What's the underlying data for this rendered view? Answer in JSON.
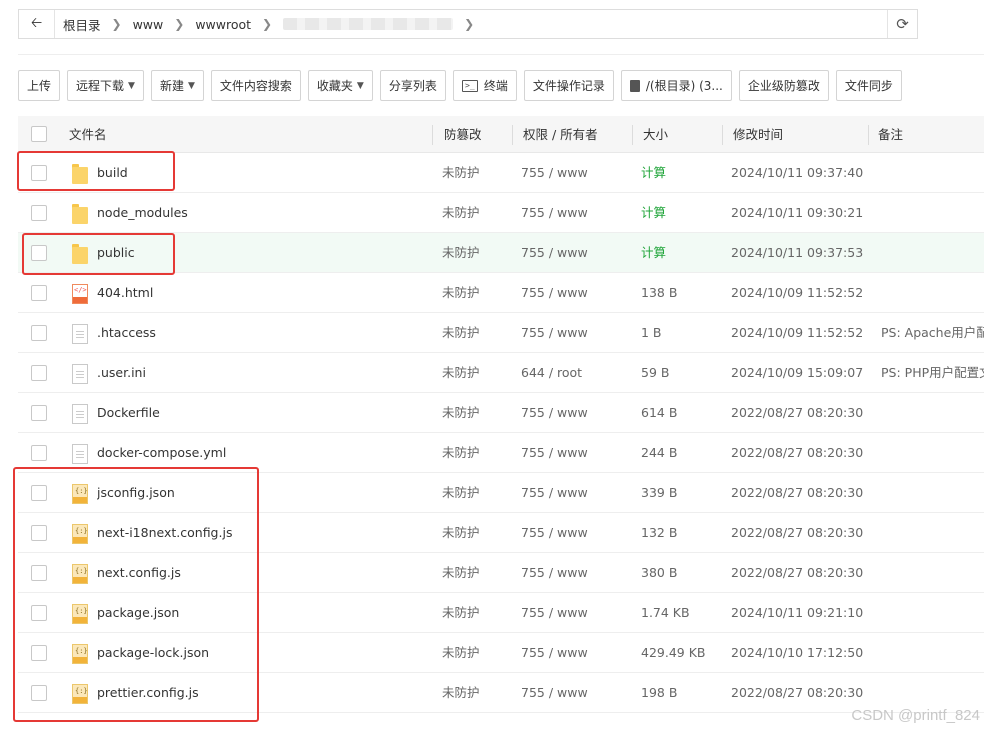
{
  "addressbar": {
    "crumbs": [
      "根目录",
      "www",
      "wwwroot"
    ]
  },
  "toolbar": {
    "upload": "上传",
    "remote_download": "远程下载",
    "new": "新建",
    "content_search": "文件内容搜索",
    "favorites": "收藏夹",
    "share_list": "分享列表",
    "terminal": "终端",
    "operation_log": "文件操作记录",
    "disk": "/(根目录) (3...",
    "tamper_protect": "企业级防篡改",
    "file_sync": "文件同步"
  },
  "table": {
    "headers": {
      "name": "文件名",
      "protect": "防篡改",
      "perm": "权限 / 所有者",
      "size": "大小",
      "mtime": "修改时间",
      "note": "备注"
    },
    "rows": [
      {
        "name": "build",
        "icon": "folder",
        "protect": "未防护",
        "perm": "755 / www",
        "size": "计算",
        "mtime": "2024/10/11 09:37:40",
        "note": ""
      },
      {
        "name": "node_modules",
        "icon": "folder",
        "protect": "未防护",
        "perm": "755 / www",
        "size": "计算",
        "mtime": "2024/10/11 09:30:21",
        "note": ""
      },
      {
        "name": "public",
        "icon": "folder",
        "protect": "未防护",
        "perm": "755 / www",
        "size": "计算",
        "mtime": "2024/10/11 09:37:53",
        "note": ""
      },
      {
        "name": "404.html",
        "icon": "html",
        "protect": "未防护",
        "perm": "755 / www",
        "size": "138 B",
        "mtime": "2024/10/09 11:52:52",
        "note": ""
      },
      {
        "name": ".htaccess",
        "icon": "doc",
        "protect": "未防护",
        "perm": "755 / www",
        "size": "1 B",
        "mtime": "2024/10/09 11:52:52",
        "note": "PS: Apache用户配置"
      },
      {
        "name": ".user.ini",
        "icon": "doc",
        "protect": "未防护",
        "perm": "644 / root",
        "size": "59 B",
        "mtime": "2024/10/09 15:09:07",
        "note": "PS: PHP用户配置文"
      },
      {
        "name": "Dockerfile",
        "icon": "doc",
        "protect": "未防护",
        "perm": "755 / www",
        "size": "614 B",
        "mtime": "2022/08/27 08:20:30",
        "note": ""
      },
      {
        "name": "docker-compose.yml",
        "icon": "doc",
        "protect": "未防护",
        "perm": "755 / www",
        "size": "244 B",
        "mtime": "2022/08/27 08:20:30",
        "note": ""
      },
      {
        "name": "jsconfig.json",
        "icon": "json",
        "protect": "未防护",
        "perm": "755 / www",
        "size": "339 B",
        "mtime": "2022/08/27 08:20:30",
        "note": ""
      },
      {
        "name": "next-i18next.config.js",
        "icon": "json",
        "protect": "未防护",
        "perm": "755 / www",
        "size": "132 B",
        "mtime": "2022/08/27 08:20:30",
        "note": ""
      },
      {
        "name": "next.config.js",
        "icon": "json",
        "protect": "未防护",
        "perm": "755 / www",
        "size": "380 B",
        "mtime": "2022/08/27 08:20:30",
        "note": ""
      },
      {
        "name": "package.json",
        "icon": "json",
        "protect": "未防护",
        "perm": "755 / www",
        "size": "1.74 KB",
        "mtime": "2024/10/11 09:21:10",
        "note": ""
      },
      {
        "name": "package-lock.json",
        "icon": "json",
        "protect": "未防护",
        "perm": "755 / www",
        "size": "429.49 KB",
        "mtime": "2024/10/10 17:12:50",
        "note": ""
      },
      {
        "name": "prettier.config.js",
        "icon": "json",
        "protect": "未防护",
        "perm": "755 / www",
        "size": "198 B",
        "mtime": "2022/08/27 08:20:30",
        "note": ""
      }
    ]
  },
  "colors": {
    "accent_green": "#20a53a",
    "highlight_red": "#e53935"
  },
  "watermark": "CSDN @printf_824"
}
